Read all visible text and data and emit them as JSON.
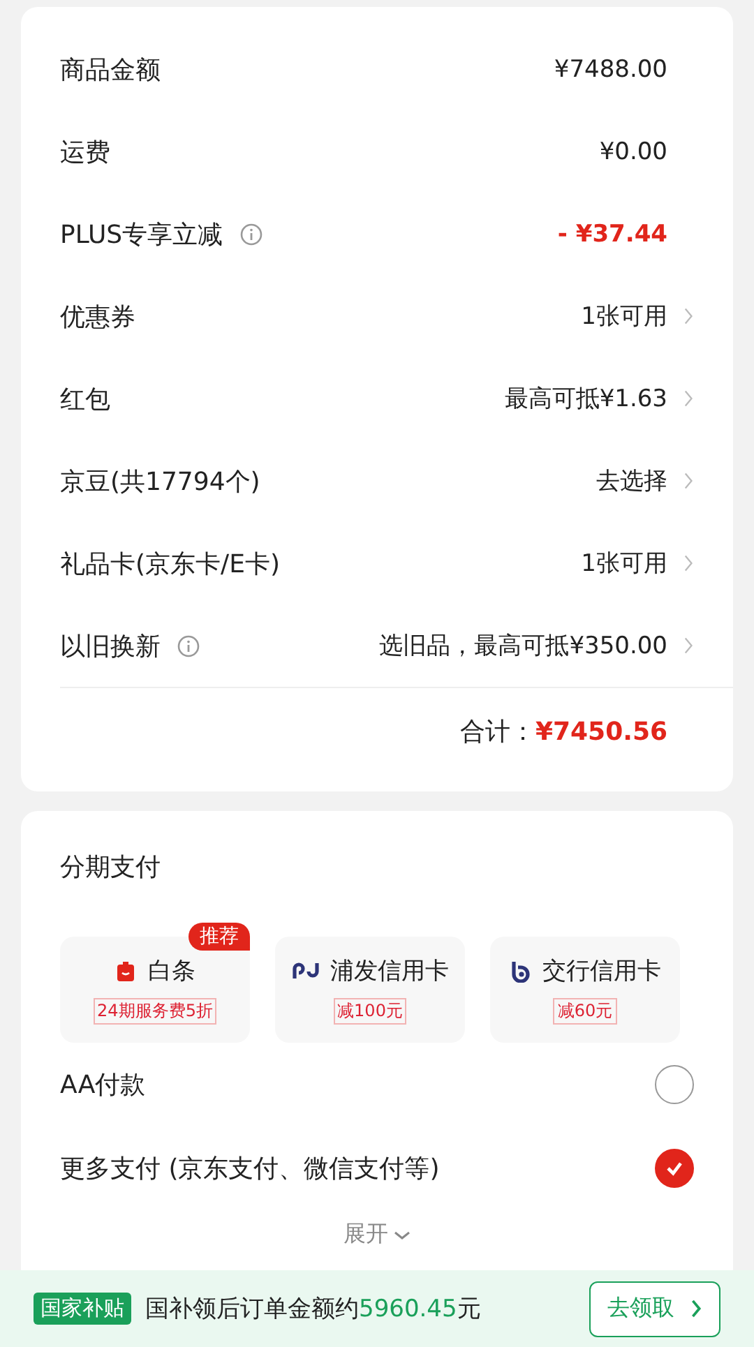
{
  "summary": {
    "rows": [
      {
        "label": "商品金额",
        "value": "¥7488.00",
        "discount": false,
        "info": false,
        "chevron": false
      },
      {
        "label": "运费",
        "value": "¥0.00",
        "discount": false,
        "info": false,
        "chevron": false
      },
      {
        "label": "PLUS专享立减",
        "value": "- ¥37.44",
        "discount": true,
        "info": true,
        "chevron": false
      },
      {
        "label": "优惠券",
        "value": "1张可用",
        "discount": false,
        "info": false,
        "chevron": true
      },
      {
        "label": "红包",
        "value": "最高可抵¥1.63",
        "discount": false,
        "info": false,
        "chevron": true
      },
      {
        "label": "京豆(共17794个)",
        "value": "去选择",
        "discount": false,
        "info": false,
        "chevron": true
      },
      {
        "label": "礼品卡(京东卡/E卡)",
        "value": "1张可用",
        "discount": false,
        "info": false,
        "chevron": true
      },
      {
        "label": "以旧换新",
        "value": "选旧品，最高可抵¥350.00",
        "discount": false,
        "info": true,
        "chevron": true
      }
    ],
    "total_label": "合计：",
    "total_value": "¥7450.56"
  },
  "payment": {
    "title": "分期支付",
    "cards": [
      {
        "kind": "baitiao",
        "name": "白条",
        "offer": "24期服务费5折",
        "badge": "推荐"
      },
      {
        "kind": "spdb",
        "name": "浦发信用卡",
        "offer": "减100元"
      },
      {
        "kind": "bocom",
        "name": "交行信用卡",
        "offer": "减60元"
      }
    ],
    "options": [
      {
        "label": "AA付款",
        "selected": false
      },
      {
        "label": "更多支付 (京东支付、微信支付等)",
        "selected": true
      }
    ],
    "expand": "展开"
  },
  "banner": {
    "tag": "国家补贴",
    "text_before": "国补领后订单金额约",
    "amount": "5960.45",
    "text_after": "元",
    "button": "去领取"
  }
}
